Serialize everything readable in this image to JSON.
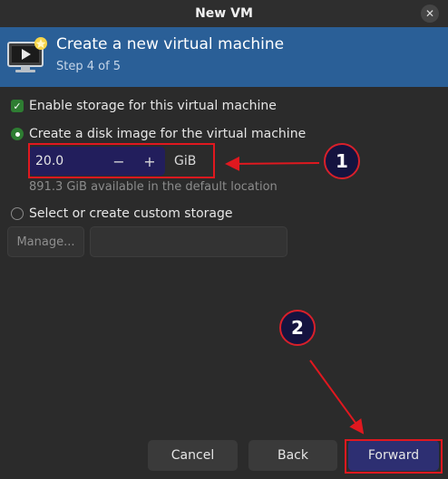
{
  "window": {
    "title": "New VM"
  },
  "header": {
    "title": "Create a new virtual machine",
    "step": "Step 4 of 5"
  },
  "storage": {
    "enable_label": "Enable storage for this virtual machine",
    "create_disk_label": "Create a disk image for the virtual machine",
    "disk_size": "20.0",
    "unit": "GiB",
    "available": "891.3 GiB available in the default location",
    "custom_label": "Select or create custom storage",
    "manage_label": "Manage...",
    "path_value": ""
  },
  "footer": {
    "cancel": "Cancel",
    "back": "Back",
    "forward": "Forward"
  },
  "annotations": {
    "one": "1",
    "two": "2"
  },
  "colors": {
    "header": "#2a5f97",
    "accent": "#2e7d32",
    "annotation": "#e0181f",
    "forward": "#2d2f72"
  }
}
